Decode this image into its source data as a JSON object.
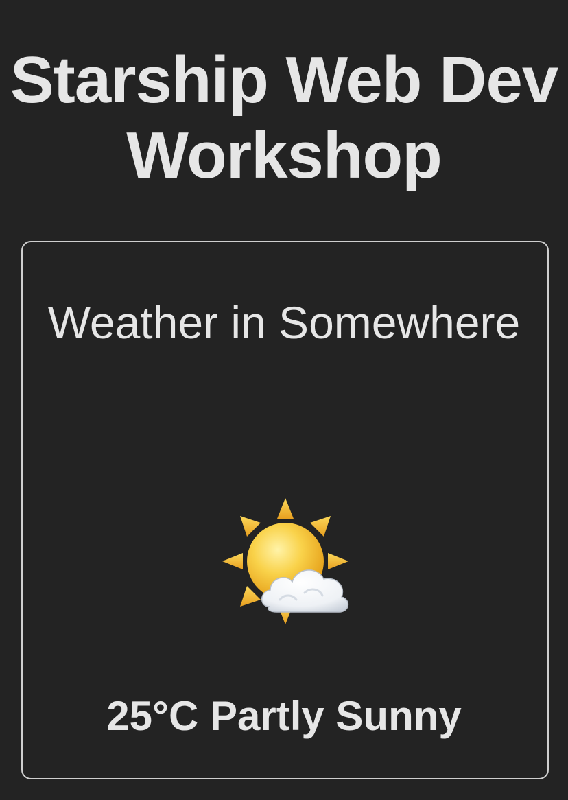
{
  "page": {
    "title": "Starship Web Dev Workshop"
  },
  "weather_card": {
    "heading": "Weather in Somewhere",
    "icon": "sun-behind-cloud-icon",
    "summary": "25°C Partly Sunny"
  },
  "colors": {
    "background": "#232323",
    "text": "#e6e6e6",
    "card_border": "#cfcfcf",
    "sun": "#f5c231",
    "cloud": "#f4f6f8"
  }
}
